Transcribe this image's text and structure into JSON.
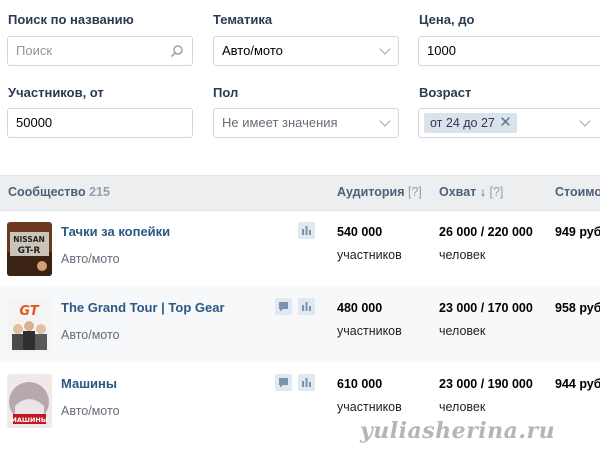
{
  "filters": {
    "search": {
      "label": "Поиск по названию",
      "placeholder": "Поиск"
    },
    "topic": {
      "label": "Тематика",
      "value": "Авто/мото"
    },
    "price": {
      "label": "Цена, до",
      "value": "1000"
    },
    "members": {
      "label": "Участников, от",
      "value": "50000"
    },
    "gender": {
      "label": "Пол",
      "value": "Не имеет значения"
    },
    "age": {
      "label": "Возраст",
      "tag": "от 24 до 27",
      "remove": "✕"
    }
  },
  "table": {
    "headers": {
      "community": "Сообщество",
      "community_count": "215",
      "audience": "Аудитория",
      "reach": "Охват ↓",
      "hint": "[?]",
      "cost": "Стоимос"
    },
    "rows": [
      {
        "name": "Тачки за копейки",
        "category": "Авто/мото",
        "audience": "540 000",
        "audience_unit": "участников",
        "reach": "26 000 / 220 000",
        "reach_unit": "человек",
        "cost": "949 руб."
      },
      {
        "name": "The Grand Tour | Top Gear",
        "category": "Авто/мото",
        "audience": "480 000",
        "audience_unit": "участников",
        "reach": "23 000 / 170 000",
        "reach_unit": "человек",
        "cost": "958 руб."
      },
      {
        "name": "Машины",
        "category": "Авто/мото",
        "audience": "610 000",
        "audience_unit": "участников",
        "reach": "23 000 / 190 000",
        "reach_unit": "человек",
        "cost": "944 руб."
      }
    ]
  },
  "watermark": "yuliasherina.ru",
  "avatar_text": {
    "a1_l1": "NISSAN",
    "a1_l2": "GT-R",
    "a2": "GT",
    "a3": "МАШИНЫ"
  },
  "colors": {
    "link": "#2a5885",
    "header_bg": "#edeef0",
    "tag_bg": "#dae2ea"
  }
}
